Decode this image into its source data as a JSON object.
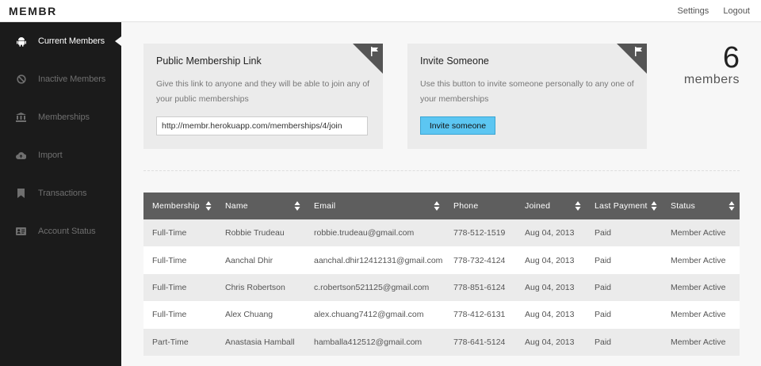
{
  "app": {
    "logo": "MEMBR"
  },
  "toplinks": {
    "settings": "Settings",
    "logout": "Logout"
  },
  "sidebar": {
    "items": [
      {
        "label": "Current Members",
        "icon": "android-icon",
        "active": true
      },
      {
        "label": "Inactive Members",
        "icon": "ban-icon",
        "active": false
      },
      {
        "label": "Memberships",
        "icon": "bank-icon",
        "active": false
      },
      {
        "label": "Import",
        "icon": "cloud-upload-icon",
        "active": false
      },
      {
        "label": "Transactions",
        "icon": "bookmark-icon",
        "active": false
      },
      {
        "label": "Account Status",
        "icon": "id-card-icon",
        "active": false
      }
    ]
  },
  "public_link": {
    "title": "Public Membership Link",
    "description": "Give this link to anyone and they will be able to join any of your public memberships",
    "url": "http://membr.herokuapp.com/memberships/4/join"
  },
  "invite": {
    "title": "Invite Someone",
    "description": "Use this button to invite someone personally to any one of your memberships",
    "button_label": "Invite someone"
  },
  "member_count": {
    "number": "6",
    "label": "members"
  },
  "table": {
    "headers": [
      "Membership",
      "Name",
      "Email",
      "Phone",
      "Joined",
      "Last Payment",
      "Status"
    ],
    "rows": [
      [
        "Full-Time",
        "Robbie Trudeau",
        "robbie.trudeau@gmail.com",
        "778-512-1519",
        "Aug 04, 2013",
        "Paid",
        "Member Active"
      ],
      [
        "Full-Time",
        "Aanchal Dhir",
        "aanchal.dhir12412131@gmail.com",
        "778-732-4124",
        "Aug 04, 2013",
        "Paid",
        "Member Active"
      ],
      [
        "Full-Time",
        "Chris Robertson",
        "c.robertson521125@gmail.com",
        "778-851-6124",
        "Aug 04, 2013",
        "Paid",
        "Member Active"
      ],
      [
        "Full-Time",
        "Alex Chuang",
        "alex.chuang7412@gmail.com",
        "778-412-6131",
        "Aug 04, 2013",
        "Paid",
        "Member Active"
      ],
      [
        "Part-Time",
        "Anastasia Hamball",
        "hamballa412512@gmail.com",
        "778-641-5124",
        "Aug 04, 2013",
        "Paid",
        "Member Active"
      ]
    ]
  },
  "colors": {
    "sidebar_bg": "#1b1b1b",
    "accent_button": "#5cc6f2",
    "table_header_bg": "#5e5e5e"
  }
}
